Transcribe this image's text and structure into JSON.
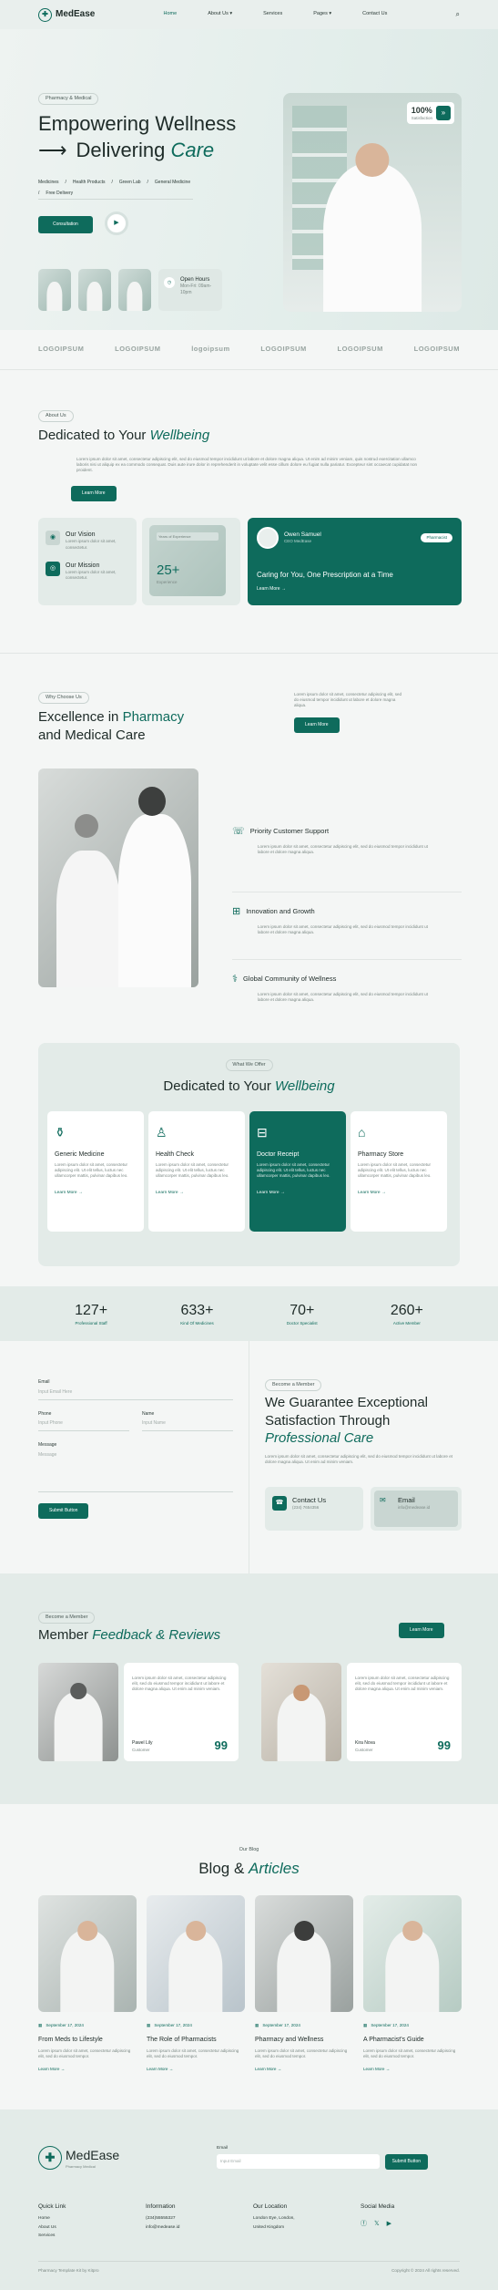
{
  "header": {
    "brand": "MedEase",
    "nav": [
      "Home",
      "About Us ▾",
      "Services",
      "Pages ▾",
      "Contact Us"
    ]
  },
  "hero": {
    "tag": "Pharmacy & Medical",
    "title_l1": "Empowering Wellness",
    "arrow": "⟶",
    "title_l2a": "Delivering ",
    "title_l2b": "Care",
    "links": [
      "Medicines",
      "/",
      "Health Products",
      "/",
      "Green Lab",
      "/",
      "General Medicine",
      "/",
      "Free Delivery"
    ],
    "cta": "Consultation",
    "badge_num": "100%",
    "badge_text": "Satisfaction",
    "hours_title": "Open Hours",
    "hours_days": "Mon-Fri: 09am-",
    "hours_time": "10pm"
  },
  "logos": [
    "LOGOIPSUM",
    "LOGOIPSUM",
    "logoipsum",
    "LOGOIPSUM",
    "LOGOIPSUM",
    "LOGOIPSUM"
  ],
  "about": {
    "tag": "About Us",
    "title_a": "Dedicated to Your ",
    "title_b": "Wellbeing",
    "text": "Lorem ipsum dolor sit amet, consectetur adipiscing elit, sed do eiusmod tempor incididunt ut labore et dolore magna aliqua. Ut enim ad minim veniam, quis nostrud exercitation ullamco laboris nisi ut aliquip ex ea commodo consequat. Duis aute irure dolor in reprehenderit in voluptate velit esse cillum dolore eu fugiat nulla pariatur. Excepteur sint occaecat cupidatat non proident.",
    "cta": "Learn More",
    "vision": "Our Vision",
    "vision_text": "Lorem ipsum dolor sit amet, consectetur.",
    "mission": "Our Mission",
    "mission_text": "Lorem ipsum dolor sit amet, consectetur.",
    "exp_label": "Years of Experience",
    "exp_num": "25+",
    "exp_sub": "Experience",
    "doc_name": "Owen Samuel",
    "doc_role": "CEO MedEase",
    "pill": "Pharmacist",
    "promo_title": "Caring for You, One Prescription at a Time",
    "promo_link": "Learn More →"
  },
  "why": {
    "tag": "Why Choose Us",
    "title_a": "Excellence in ",
    "title_b": "Pharmacy",
    "title_c": "and Medical Care",
    "text": "Lorem ipsum dolor sit amet, consectetur adipiscing elit, sed do eiusmod tempor incididunt ut labore et dolore magna aliqua.",
    "cta": "Learn More",
    "features": [
      {
        "title": "Priority Customer Support",
        "text": "Lorem ipsum dolor sit amet, consectetur adipiscing elit, sed do eiusmod tempor incididunt ut labore et dolore magna aliqua."
      },
      {
        "title": "Innovation and Growth",
        "text": "Lorem ipsum dolor sit amet, consectetur adipiscing elit, sed do eiusmod tempor incididunt ut labore et dolore magna aliqua."
      },
      {
        "title": "Global Community of Wellness",
        "text": "Lorem ipsum dolor sit amet, consectetur adipiscing elit, sed do eiusmod tempor incididunt ut labore et dolore magna aliqua."
      }
    ]
  },
  "offer": {
    "tag": "What We Offer",
    "title_a": "Dedicated to Your ",
    "title_b": "Wellbeing",
    "items": [
      {
        "title": "Generic Medicine",
        "text": "Lorem ipsum dolor sit amet, consectetur adipiscing elit. Ut elit tellus, luctus nec ullamcorper mattis, pulvinar dapibus leo.",
        "link": "Learn More →"
      },
      {
        "title": "Health Check",
        "text": "Lorem ipsum dolor sit amet, consectetur adipiscing elit. Ut elit tellus, luctus nec ullamcorper mattis, pulvinar dapibus leo.",
        "link": "Learn More →"
      },
      {
        "title": "Doctor Receipt",
        "text": "Lorem ipsum dolor sit amet, consectetur adipiscing elit. Ut elit tellus, luctus nec ullamcorper mattis, pulvinar dapibus leo.",
        "link": "Learn More →"
      },
      {
        "title": "Pharmacy Store",
        "text": "Lorem ipsum dolor sit amet, consectetur adipiscing elit. Ut elit tellus, luctus nec ullamcorper mattis, pulvinar dapibus leo.",
        "link": "Learn More →"
      }
    ]
  },
  "stats": [
    {
      "num": "127+",
      "label": "Professional Staff"
    },
    {
      "num": "633+",
      "label": "Kind Of Medicines"
    },
    {
      "num": "70+",
      "label": "Doctor Specialist"
    },
    {
      "num": "260+",
      "label": "Active Member"
    }
  ],
  "contact": {
    "email_label": "Email",
    "email_ph": "Input Email Here",
    "phone_label": "Phone",
    "phone_ph": "Input Phone",
    "name_label": "Name",
    "name_ph": "Input Name",
    "msg_label": "Message",
    "msg_ph": "Message",
    "submit": "Submit Button",
    "tag": "Become a Member",
    "title_l1": "We Guarantee Exceptional",
    "title_l2": "Satisfaction Through",
    "title_l3": "Professional Care",
    "text": "Lorem ipsum dolor sit amet, consectetur adipiscing elit, sed do eiusmod tempor incididunt ut labore et dolore magna aliqua. Ut enim ad minim veniam.",
    "c1_title": "Contact Us",
    "c1_val": "(234) 7654356",
    "c2_title": "Email",
    "c2_val": "info@medease.id"
  },
  "reviews": {
    "tag": "Become a Member",
    "title_a": "Member ",
    "title_b": "Feedback & Reviews",
    "cta": "Learn More",
    "items": [
      {
        "text": "Lorem ipsum dolor sit amet, consectetur adipiscing elit, sed do eiusmod tempor incididunt ut labore et dolore magna aliqua. Ut enim ad minim veniam.",
        "name": "Pawel Lily",
        "role": "Customer",
        "q": "99"
      },
      {
        "text": "Lorem ipsum dolor sit amet, consectetur adipiscing elit, sed do eiusmod tempor incididunt ut labore et dolore magna aliqua. Ut enim ad minim veniam.",
        "name": "Kira Nova",
        "role": "Customer",
        "q": "99"
      }
    ]
  },
  "blog": {
    "tag": "Our Blog",
    "title_a": "Blog & ",
    "title_b": "Articles",
    "items": [
      {
        "date": "September 17, 2024",
        "title": "From Meds to Lifestyle",
        "text": "Lorem ipsum dolor sit amet, consectetur adipiscing elit, sed do eiusmod tempor.",
        "link": "Learn More →"
      },
      {
        "date": "September 17, 2024",
        "title": "The Role of Pharmacists",
        "text": "Lorem ipsum dolor sit amet, consectetur adipiscing elit, sed do eiusmod tempor.",
        "link": "Learn More →"
      },
      {
        "date": "September 17, 2024",
        "title": "Pharmacy and Wellness",
        "text": "Lorem ipsum dolor sit amet, consectetur adipiscing elit, sed do eiusmod tempor.",
        "link": "Learn More →"
      },
      {
        "date": "September 17, 2024",
        "title": "A Pharmacist's Guide",
        "text": "Lorem ipsum dolor sit amet, consectetur adipiscing elit, sed do eiusmod tempor.",
        "link": "Learn More →"
      }
    ]
  },
  "footer": {
    "brand": "MedEase",
    "brand_sub": "Pharmacy Medical",
    "email_label": "Email",
    "email_ph": "Input Email",
    "submit": "Submit Button",
    "col1_title": "Quick Link",
    "col1": [
      "Home",
      "About Us",
      "Services"
    ],
    "col2_title": "Information",
    "col2": [
      "(234)55555327",
      "info@medease.id"
    ],
    "col3_title": "Our Location",
    "col3": [
      "London Eye, London,",
      "United Kingdom"
    ],
    "col4_title": "Social Media",
    "credit": "Pharmacy Template Kit by Kitpro",
    "copyright": "Copyright © 2024 All rights reserved."
  }
}
